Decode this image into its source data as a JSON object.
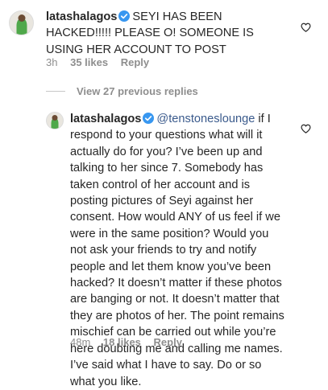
{
  "comment": {
    "username": "latashalagos",
    "text": "SEYI HAS BEEN HACKED!!!!! PLEASE O! SOMEONE IS USING HER ACCOUNT TO POST",
    "time": "3h",
    "likes": "35 likes",
    "reply": "Reply"
  },
  "view_replies": "View 27 previous replies",
  "reply": {
    "username": "latashalagos",
    "mention": "@tenstoneslounge",
    "text": " if I respond to your questions what will it actually do for you? I’ve been up and talking to her since 7. Somebody has taken control of her account and is posting pictures of Seyi against her consent. How would ANY of us feel if we were in the same position? Would you not ask your friends to try and notify people and let them know you’ve been hacked? It doesn’t matter if these photos are banging or not. It doesn’t matter that they are photos of her. The point remains mischief can be carried out while you’re here doubting me and calling me names. I’ve said what I have to say. Do or so what you like.",
    "time": "48m",
    "likes": "18 likes",
    "reply": "Reply"
  },
  "icons": {
    "verified": "verified-badge-icon",
    "like": "heart-icon",
    "avatar": "profile-photo"
  },
  "colors": {
    "verified": "#3897f0",
    "mention": "#3a5a8c",
    "meta": "#8e8e8e"
  }
}
